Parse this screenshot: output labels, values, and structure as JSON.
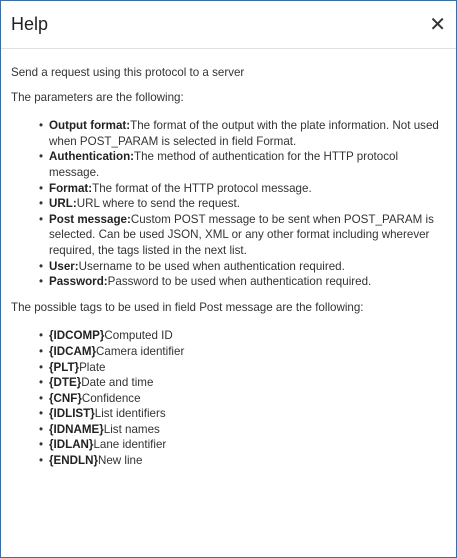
{
  "dialog": {
    "title": "Help",
    "close_glyph": "✕"
  },
  "content": {
    "intro": "Send a request using this protocol to a server",
    "params_heading": "The parameters are the following:",
    "params": [
      {
        "label": "Output format:",
        "text": "The format of the output with the plate information. Not used when POST_PARAM is selected in field Format."
      },
      {
        "label": "Authentication:",
        "text": "The method of authentication for the HTTP protocol message."
      },
      {
        "label": "Format:",
        "text": "The format of the HTTP protocol message."
      },
      {
        "label": "URL:",
        "text": "URL where to send the request."
      },
      {
        "label": "Post message:",
        "text": "Custom POST message to be sent when POST_PARAM is selected. Can be used JSON, XML or any other format including wherever required, the tags listed in the next list."
      },
      {
        "label": "User:",
        "text": "Username to be used when authentication required."
      },
      {
        "label": "Password:",
        "text": "Password to be used when authentication required."
      }
    ],
    "tags_heading": "The possible tags to be used in field Post message are the following:",
    "tags": [
      {
        "label": "{IDCOMP}",
        "text": "Computed ID"
      },
      {
        "label": "{IDCAM}",
        "text": "Camera identifier"
      },
      {
        "label": "{PLT}",
        "text": "Plate"
      },
      {
        "label": "{DTE}",
        "text": "Date and time"
      },
      {
        "label": "{CNF}",
        "text": "Confidence"
      },
      {
        "label": "{IDLIST}",
        "text": "List identifiers"
      },
      {
        "label": "{IDNAME}",
        "text": "List names"
      },
      {
        "label": "{IDLAN}",
        "text": "Lane identifier"
      },
      {
        "label": "{ENDLN}",
        "text": "New line"
      }
    ]
  },
  "colors": {
    "border": "#3a6ea5",
    "text": "#333333"
  }
}
